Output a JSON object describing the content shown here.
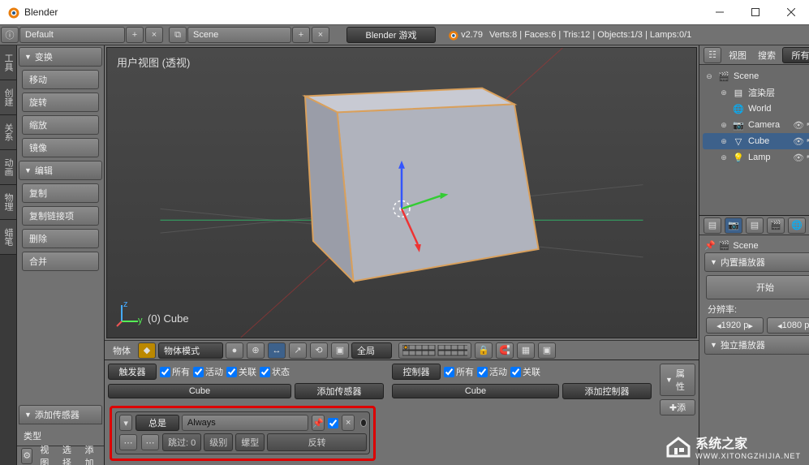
{
  "app": {
    "title": "Blender"
  },
  "topbar": {
    "layout": "Default",
    "scene": "Scene",
    "engine": "Blender 游戏",
    "version": "v2.79",
    "stats": "Verts:8 | Faces:6 | Tris:12 | Objects:1/3 | Lamps:0/1"
  },
  "left_tabs": [
    "工具",
    "创建",
    "关系",
    "动画",
    "物理",
    "蜡笔"
  ],
  "tool_panels": {
    "transform": {
      "title": "变换",
      "items": [
        "移动",
        "旋转",
        "缩放",
        "镜像"
      ]
    },
    "edit": {
      "title": "编辑",
      "items": [
        "复制",
        "复制链接项",
        "删除",
        "合并"
      ]
    },
    "add_sensor": {
      "title": "添加传感器",
      "type_label": "类型"
    }
  },
  "viewport": {
    "label": "用户视图  (透视)",
    "object": "(0) Cube",
    "header": {
      "menus": [
        "视图",
        "选择",
        "添加",
        "物体"
      ],
      "mode": "物体模式",
      "orientation": "全局"
    }
  },
  "logic": {
    "sensor_col": {
      "label": "触发器",
      "all": "所有",
      "sel": "活动",
      "link": "关联",
      "state": "状态"
    },
    "controller_col": {
      "label": "控制器",
      "all": "所有",
      "sel": "活动",
      "link": "关联"
    },
    "actuator_col": {
      "label": "属性"
    },
    "object": "Cube",
    "add_sensor": "添加传感器",
    "add_controller": "添加控制器",
    "add_btn": "添",
    "sensor": {
      "type": "总是",
      "name": "Always",
      "skip_label": "跳过:",
      "skip_val": "0",
      "level": "级别",
      "tap": "螺型",
      "invert": "反转"
    }
  },
  "outliner": {
    "menus": [
      "视图",
      "搜索"
    ],
    "filter": "所有场",
    "root": "Scene",
    "items": [
      {
        "name": "渲染层",
        "icon": "layers"
      },
      {
        "name": "World",
        "icon": "world"
      },
      {
        "name": "Camera",
        "icon": "camera",
        "restrict": true
      },
      {
        "name": "Cube",
        "icon": "mesh",
        "restrict": true,
        "selected": true
      },
      {
        "name": "Lamp",
        "icon": "lamp",
        "restrict": true
      }
    ]
  },
  "properties": {
    "context": "Scene",
    "panel1": "内置播放器",
    "start": "开始",
    "res_label": "分辨率:",
    "res_x": "1920 p",
    "res_y": "1080 p",
    "panel2": "独立播放器"
  },
  "watermark": {
    "name": "系统之家",
    "url": "WWW.XITONGZHIJIA.NET"
  }
}
